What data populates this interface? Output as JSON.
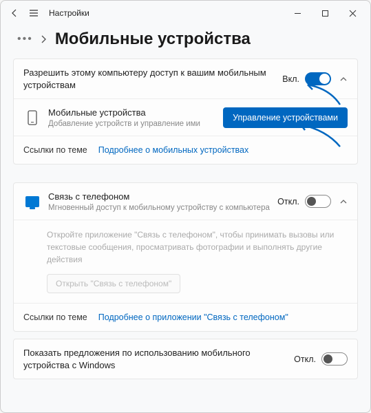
{
  "titlebar": {
    "app_name": "Настройки"
  },
  "header": {
    "page_title": "Мобильные устройства"
  },
  "card1": {
    "allow": {
      "title": "Разрешить этому компьютеру доступ к вашим мобильным устройствам",
      "state": "Вкл."
    },
    "devices": {
      "title": "Мобильные устройства",
      "sub": "Добавление устройств и управление ими",
      "button": "Управление устройствами"
    },
    "links": {
      "label": "Ссылки по теме",
      "link": "Подробнее о мобильных устройствах"
    }
  },
  "card2": {
    "phone": {
      "title": "Связь с телефоном",
      "sub": "Мгновенный доступ к мобильному устройству с компьютера",
      "state": "Откл.",
      "desc": "Откройте приложение \"Связь с телефоном\", чтобы принимать вызовы или текстовые сообщения, просматривать фотографии и выполнять другие действия",
      "open_button": "Открыть \"Связь с телефоном\""
    },
    "links": {
      "label": "Ссылки по теме",
      "link": "Подробнее о приложении \"Связь с телефоном\""
    }
  },
  "card3": {
    "suggest": {
      "title": "Показать предложения по использованию мобильного устройства с Windows",
      "state": "Откл."
    }
  }
}
